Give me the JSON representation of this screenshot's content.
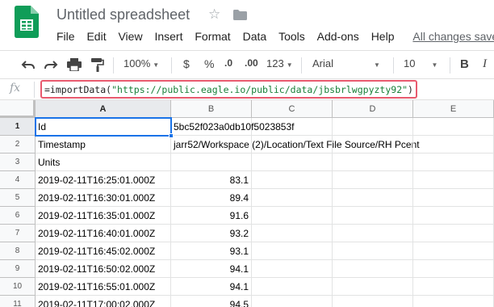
{
  "doc": {
    "title": "Untitled spreadsheet"
  },
  "menu": [
    "File",
    "Edit",
    "View",
    "Insert",
    "Format",
    "Data",
    "Tools",
    "Add-ons",
    "Help"
  ],
  "saved_status": "All changes save",
  "toolbar": {
    "zoom": "100%",
    "currency": "$",
    "percent": "%",
    "dec_decrease": ".0",
    "dec_increase": ".00",
    "more_formats": "123",
    "font": "Arial",
    "font_size": "10",
    "bold": "B",
    "italic": "I"
  },
  "formula_bar": {
    "fx": "fx",
    "formula_prefix": "=importData(",
    "formula_string": "\"https://public.eagle.io/public/data/jbsbrlwgpyzty92\"",
    "formula_suffix": ")"
  },
  "columns": [
    "A",
    "B",
    "C",
    "D",
    "E"
  ],
  "rows": [
    {
      "num": "1",
      "a": "Id",
      "b": "5bc52f023a0db10f5023853f"
    },
    {
      "num": "2",
      "a": "Timestamp",
      "b": "jarr52/Workspace (2)/Location/Text File Source/RH Pcent"
    },
    {
      "num": "3",
      "a": "Units",
      "b": ""
    },
    {
      "num": "4",
      "a": "2019-02-11T16:25:01.000Z",
      "b": "83.1"
    },
    {
      "num": "5",
      "a": "2019-02-11T16:30:01.000Z",
      "b": "89.4"
    },
    {
      "num": "6",
      "a": "2019-02-11T16:35:01.000Z",
      "b": "91.6"
    },
    {
      "num": "7",
      "a": "2019-02-11T16:40:01.000Z",
      "b": "93.2"
    },
    {
      "num": "8",
      "a": "2019-02-11T16:45:02.000Z",
      "b": "93.1"
    },
    {
      "num": "9",
      "a": "2019-02-11T16:50:02.000Z",
      "b": "94.1"
    },
    {
      "num": "10",
      "a": "2019-02-11T16:55:01.000Z",
      "b": "94.1"
    },
    {
      "num": "11",
      "a": "2019-02-11T17:00:02.000Z",
      "b": "94.5"
    }
  ],
  "colors": {
    "logo": "#0f9d58",
    "selection": "#1a73e8",
    "formula_highlight": "#e85a6e",
    "string_green": "#188038"
  },
  "icons": [
    "sheets-logo-icon",
    "star-icon",
    "folder-icon",
    "undo-icon",
    "redo-icon",
    "print-icon",
    "paint-format-icon"
  ]
}
